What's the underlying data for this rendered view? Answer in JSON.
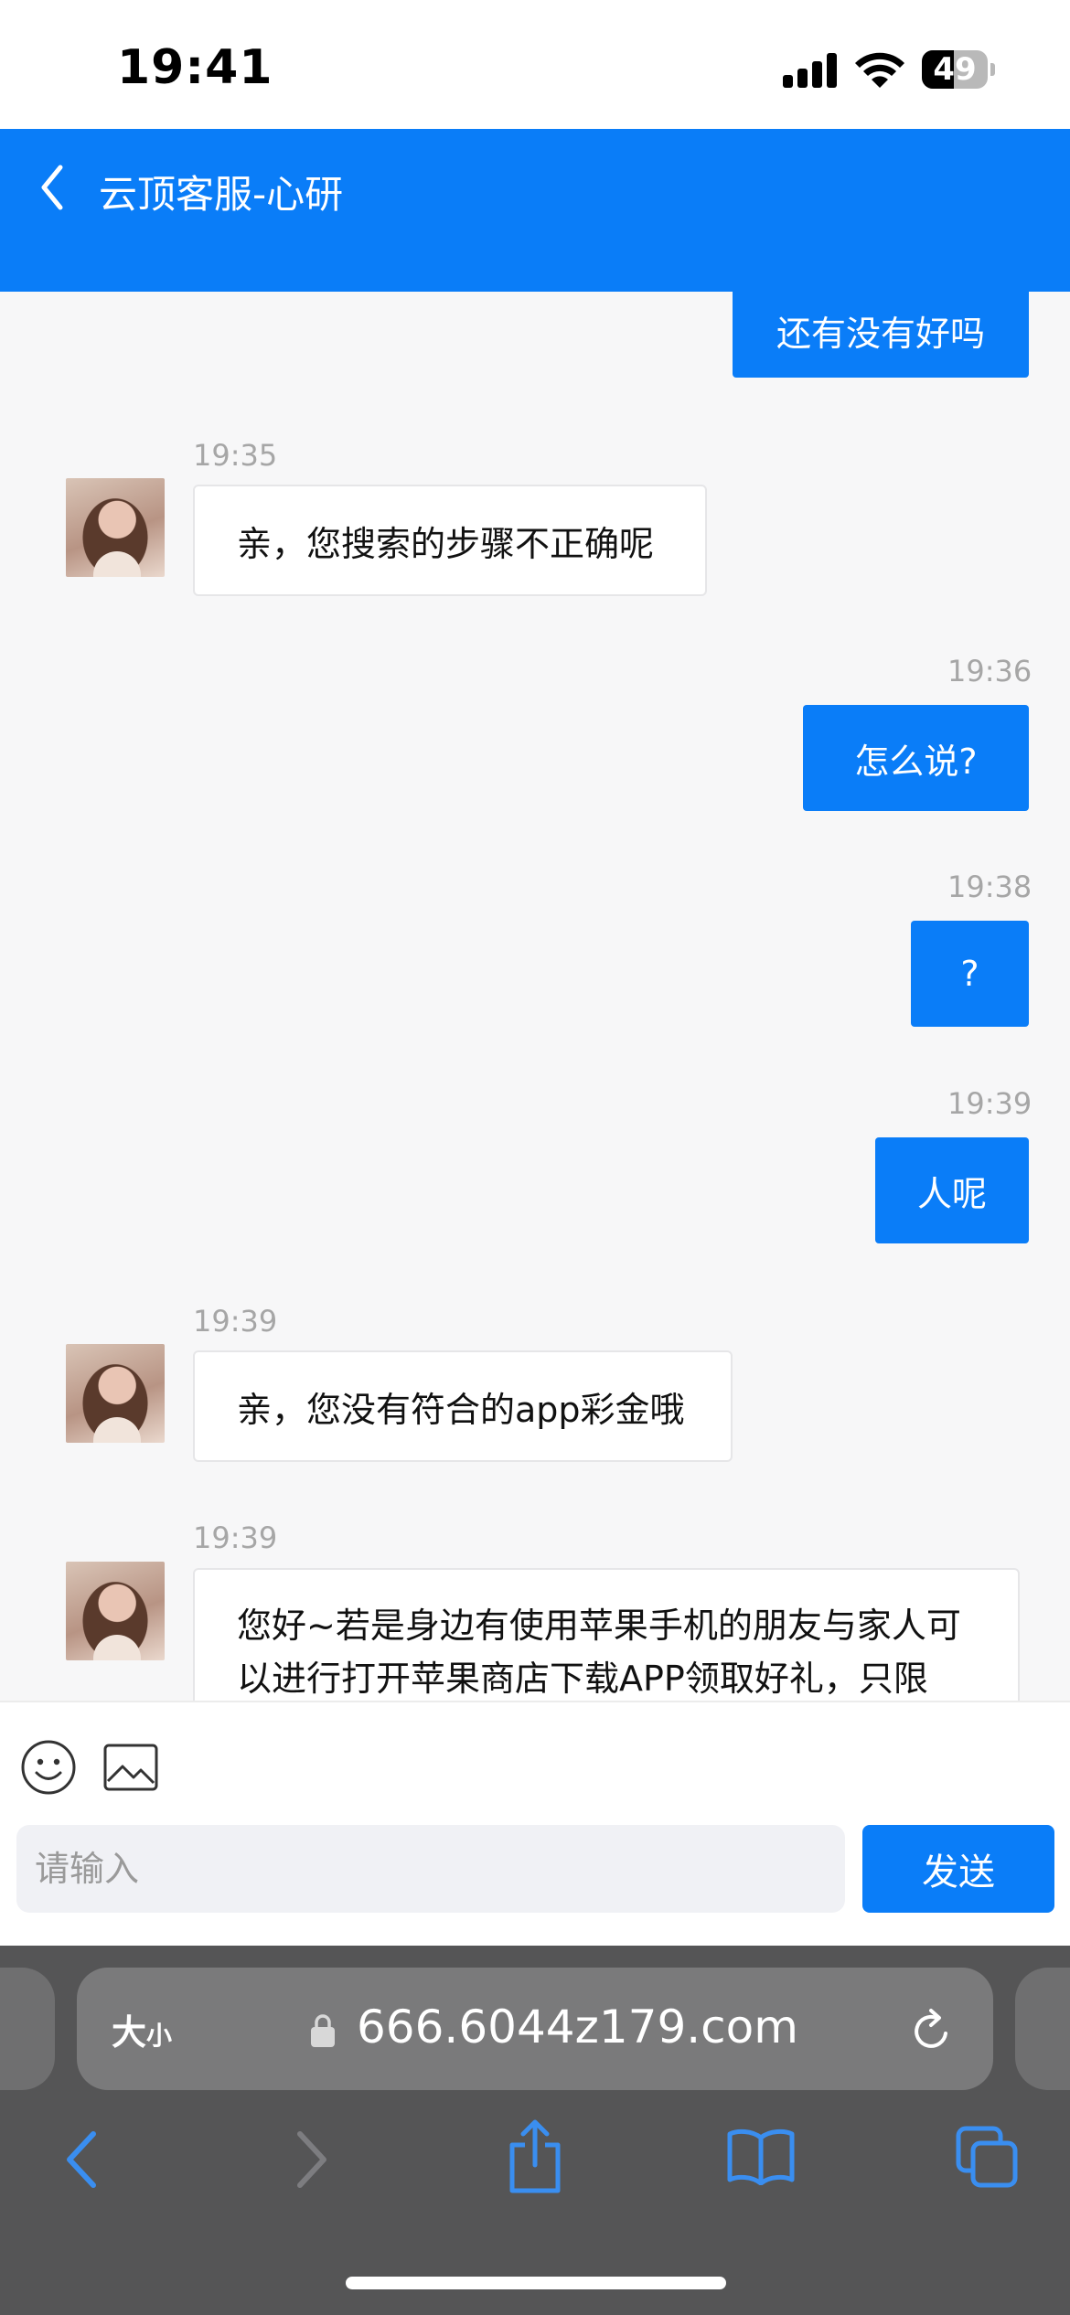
{
  "status_bar": {
    "time": "19:41",
    "battery": "49",
    "battery_level": 0.49
  },
  "header": {
    "title": "云顶客服-心研",
    "back_icon": "chevron-left-icon"
  },
  "messages": [
    {
      "id": "m0",
      "direction": "out",
      "time": "",
      "text": "还有没有好吗"
    },
    {
      "id": "m1",
      "direction": "in",
      "time": "19:35",
      "text": "亲，您搜索的步骤不正确呢"
    },
    {
      "id": "m2",
      "direction": "out",
      "time": "19:36",
      "text": "怎么说?"
    },
    {
      "id": "m3",
      "direction": "out",
      "time": "19:38",
      "text": "?"
    },
    {
      "id": "m4",
      "direction": "out",
      "time": "19:39",
      "text": "人呢"
    },
    {
      "id": "m5",
      "direction": "in",
      "time": "19:39",
      "text": "亲，您没有符合的app彩金哦"
    },
    {
      "id": "m6",
      "direction": "in",
      "time": "19:39",
      "text_line1": "您好~若是身边有使用苹果手机的朋友与家人可",
      "text_line2": "以进行打开苹果商店下载APP领取好礼，只限"
    }
  ],
  "composer": {
    "emoji_icon": "smiley-icon",
    "image_icon": "image-icon",
    "placeholder": "请输入",
    "send_label": "发送"
  },
  "browser": {
    "text_size_label": "大",
    "text_size_label_small": "小",
    "url": "666.6044z179.com",
    "icons": [
      "back-arrow-icon",
      "forward-arrow-icon",
      "share-icon",
      "bookmarks-icon",
      "tabs-icon"
    ]
  }
}
